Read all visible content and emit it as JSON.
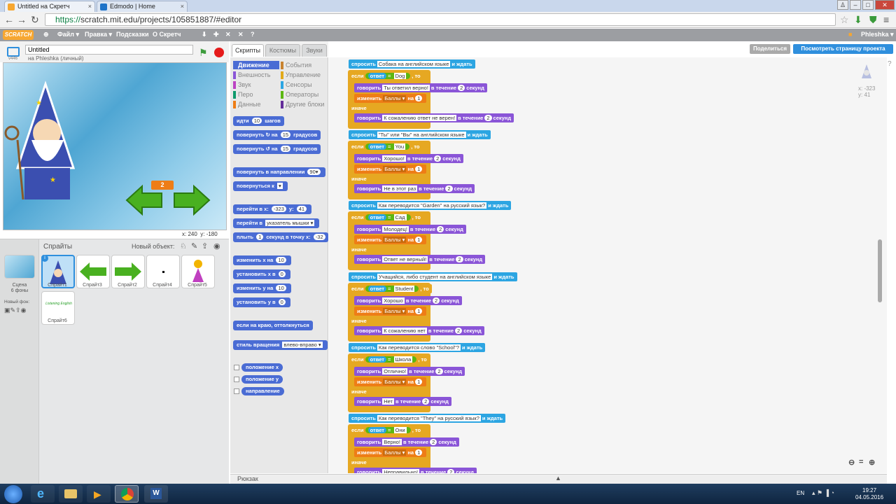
{
  "browser": {
    "tabs": [
      {
        "title": "Untitled на Скретч"
      },
      {
        "title": "Edmodo | Home"
      }
    ],
    "url_scheme": "https://",
    "url_rest": "scratch.mit.edu/projects/105851887/#editor"
  },
  "menubar": {
    "logo": "SCRATCH",
    "file": "Файл ▾",
    "edit": "Правка ▾",
    "tips": "Подсказки",
    "about": "О Скретч",
    "user": "Phleshka ▾"
  },
  "project": {
    "title": "Untitled",
    "owner": "на Phleshka (личный)",
    "version": "v446"
  },
  "stage": {
    "score": "2",
    "coord_x": "x: 240",
    "coord_y": "y: -180"
  },
  "sprites": {
    "header": "Спрайты",
    "new_sprite": "Новый объект:",
    "scene_label": "Сцена",
    "scene_count": "6 фоны",
    "new_backdrop": "Новый фон:",
    "items": [
      {
        "name": "Спрайт1"
      },
      {
        "name": "Спрайт3"
      },
      {
        "name": "Спрайт2"
      },
      {
        "name": "Спрайт4"
      },
      {
        "name": "Спрайт5"
      },
      {
        "name": "Спрайт6"
      }
    ],
    "sprite6_text": "Listening English"
  },
  "tabs": {
    "scripts": "Скрипты",
    "costumes": "Костюмы",
    "sounds": "Звуки"
  },
  "categories": [
    {
      "label": "Движение",
      "color": "#4a6cd4"
    },
    {
      "label": "События",
      "color": "#c88330"
    },
    {
      "label": "Внешность",
      "color": "#8a55d7"
    },
    {
      "label": "Управление",
      "color": "#e1a91a"
    },
    {
      "label": "Звук",
      "color": "#bb42c3"
    },
    {
      "label": "Сенсоры",
      "color": "#2ca5e2"
    },
    {
      "label": "Перо",
      "color": "#0e9a6c"
    },
    {
      "label": "Операторы",
      "color": "#5cb712"
    },
    {
      "label": "Данные",
      "color": "#ee7d16"
    },
    {
      "label": "Другие блоки",
      "color": "#632d99"
    }
  ],
  "palette": {
    "b1": "идти",
    "b1n": "10",
    "b1t": "шагов",
    "b2": "повернуть ↻ на",
    "b2n": "15",
    "b2t": "градусов",
    "b3": "повернуть ↺ на",
    "b3n": "15",
    "b3t": "градусов",
    "b4": "повернуть в направлении",
    "b4n": "90▾",
    "b5": "повернуться к",
    "b5n": "▾",
    "b6": "перейти в x:",
    "b6x": "-323",
    "b6y": "y:",
    "b6yn": "41",
    "b7": "перейти в",
    "b7n": "указатель мышки ▾",
    "b8": "плыть",
    "b8n": "1",
    "b8t": "секунд в точку x:",
    "b8x": "-32",
    "b9": "изменить x на",
    "b9n": "10",
    "b10": "установить x в",
    "b10n": "0",
    "b11": "изменить y на",
    "b11n": "10",
    "b12": "установить y в",
    "b12n": "0",
    "b13": "если на краю, оттолкнуться",
    "b14": "стиль вращения",
    "b14n": "влево-вправо ▾",
    "r1": "положение x",
    "r2": "положение y",
    "r3": "направление"
  },
  "script_labels": {
    "ask": "спросить",
    "wait": "и ждать",
    "if": "если",
    "answer": "ответ",
    "then": ", то",
    "say": "говорить",
    "for": "в течение",
    "seconds": "секунд",
    "change": "изменить",
    "by": "на",
    "var": "Баллы ▾",
    "else": "иначе",
    "eq": "="
  },
  "scripts": [
    {
      "q": "Собака на английском языке",
      "a": "Dog",
      "ok": "Ты ответил верно!",
      "okn": "2",
      "bad": "К сожалению ответ не верен!",
      "badn": "2"
    },
    {
      "q": "\"Ты\" или \"Вы\" на английском языке",
      "a": "You",
      "ok": "Хорошо!",
      "okn": "2",
      "bad": "Не в этот раз",
      "badn": "2"
    },
    {
      "q": "Как переводится \"Garden\" на русский язык?",
      "a": "Сад",
      "ok": "Молодец!",
      "okn": "2",
      "bad": "Ответ не верный!",
      "badn": "2"
    },
    {
      "q": "Учащийся, либо студент на английском языке",
      "a": "Student",
      "ok": "Хорошо",
      "okn": "2",
      "bad": "К сожалению нет",
      "badn": "2"
    },
    {
      "q": "Как переводится слово \"School\"?",
      "a": "Школа",
      "ok": "Отлично!",
      "okn": "2",
      "bad": "Нет",
      "badn": "2"
    },
    {
      "q": "Как переводится \"They\" на русский язык?",
      "a": "Они",
      "ok": "Верно!",
      "okn": "2",
      "bad": "Неправильно!",
      "badn": "2"
    }
  ],
  "sprite_info": {
    "x": "x: -323",
    "y": "y: 41"
  },
  "buttons": {
    "share": "Поделиться",
    "view": "Посмотреть страницу проекта"
  },
  "backpack": "Рюкзак",
  "taskbar": {
    "lang": "EN",
    "time": "19:27",
    "date": "04.05.2016"
  }
}
